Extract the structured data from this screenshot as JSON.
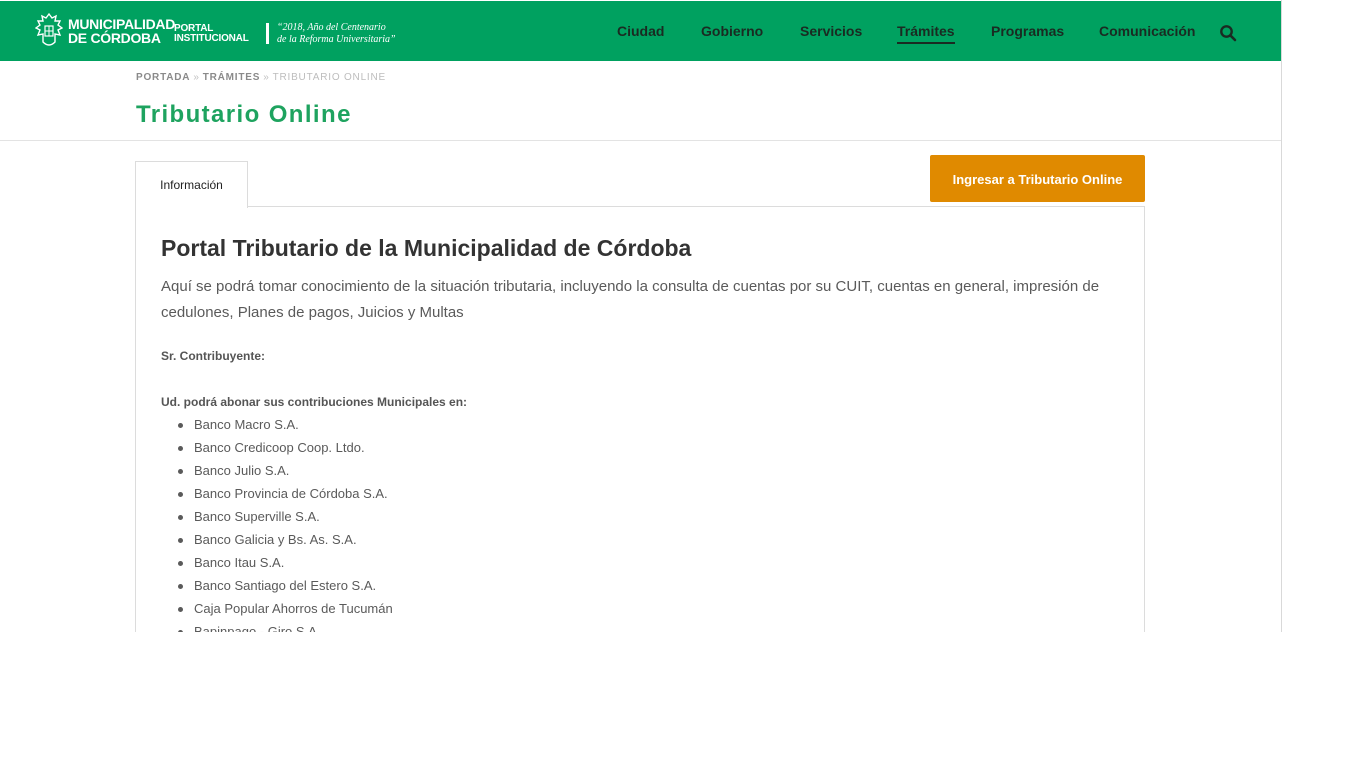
{
  "header": {
    "brand_line1": "MUNICIPALIDAD",
    "brand_line2": "DE CÓRDOBA",
    "portal_line1": "PORTAL",
    "portal_line2": "INSTITUCIONAL",
    "motto_line1": "“2018, Año del Centenario",
    "motto_line2": "de la Reforma Universitaria”",
    "nav": [
      {
        "label": "Ciudad"
      },
      {
        "label": "Gobierno"
      },
      {
        "label": "Servicios"
      },
      {
        "label": "Trámites",
        "active": true
      },
      {
        "label": "Programas"
      },
      {
        "label": "Comunicación"
      }
    ],
    "search_icon": "search-icon",
    "colors": {
      "bar": "#00a160",
      "nav_text": "#1a2b22"
    }
  },
  "breadcrumb": {
    "items": [
      "PORTADA",
      "TRÁMITES"
    ],
    "current": "TRIBUTARIO ONLINE",
    "separator": "»"
  },
  "page": {
    "title": "Tributario Online",
    "title_color": "#1ea35f"
  },
  "tabs": [
    {
      "label": "Información",
      "selected": true
    }
  ],
  "cta": {
    "label": "Ingresar a Tributario Online",
    "color": "#e08a00"
  },
  "content": {
    "heading": "Portal Tributario de la Municipalidad de Córdoba",
    "lead": "Aquí se podrá tomar conocimiento de la situación tributaria, incluyendo la consulta de cuentas por su CUIT, cuentas en general, impresión de cedulones, Planes de pagos, Juicios y Multas",
    "salutation": "Sr. Contribuyente:",
    "payment_intro": "Ud. podrá abonar sus contribuciones Municipales en:",
    "banks": [
      "Banco Macro S.A.",
      "Banco Credicoop Coop. Ltdo.",
      "Banco Julio S.A.",
      "Banco Provincia de Córdoba S.A.",
      "Banco Superville S.A.",
      "Banco Galicia y Bs. As. S.A.",
      "Banco Itau S.A.",
      "Banco Santiago del Estero S.A.",
      "Caja Popular Ahorros de Tucumán",
      "Bapinpago - Giro S.A."
    ]
  }
}
